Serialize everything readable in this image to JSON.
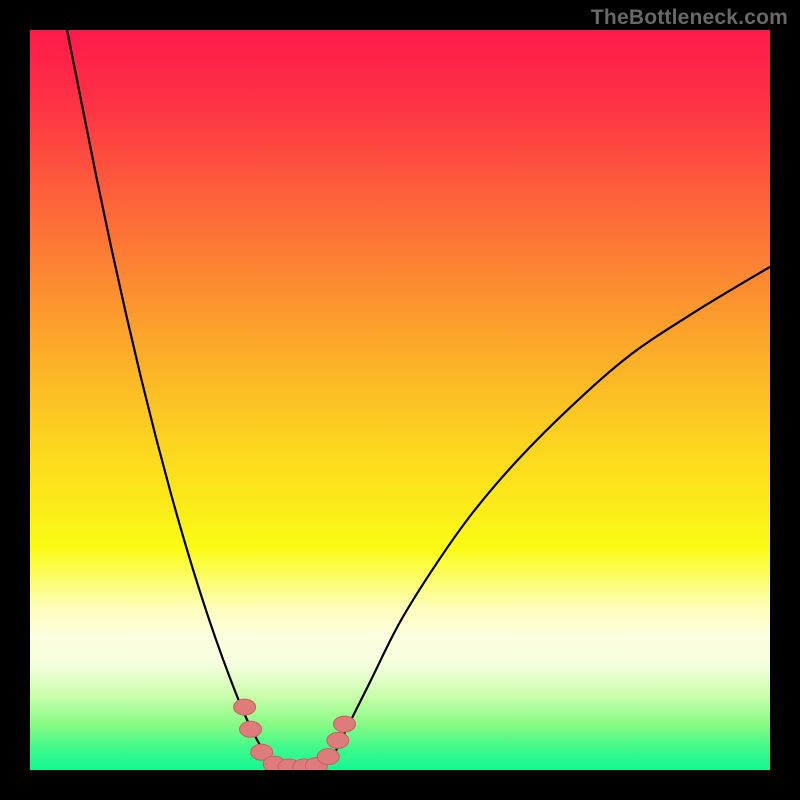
{
  "watermark": "TheBottleneck.com",
  "colors": {
    "frame": "#000000",
    "curve": "#000000",
    "marker_fill": "#dd7c7b",
    "marker_stroke": "#c96160",
    "gradient_stops": [
      {
        "offset": 0.0,
        "color": "#fe1a4b"
      },
      {
        "offset": 0.1,
        "color": "#fe3245"
      },
      {
        "offset": 0.25,
        "color": "#fd6a38"
      },
      {
        "offset": 0.4,
        "color": "#fca02c"
      },
      {
        "offset": 0.55,
        "color": "#fcd220"
      },
      {
        "offset": 0.7,
        "color": "#fbfb15"
      },
      {
        "offset": 0.78,
        "color": "#fdfeb9"
      },
      {
        "offset": 0.82,
        "color": "#fdfee0"
      },
      {
        "offset": 0.86,
        "color": "#f3fedc"
      },
      {
        "offset": 0.9,
        "color": "#c9fdaa"
      },
      {
        "offset": 0.94,
        "color": "#84fb84"
      },
      {
        "offset": 0.97,
        "color": "#40f98b"
      },
      {
        "offset": 1.0,
        "color": "#14f891"
      }
    ]
  },
  "chart_data": {
    "type": "line",
    "title": "",
    "xlabel": "",
    "ylabel": "",
    "xlim": [
      0,
      100
    ],
    "ylim": [
      0,
      100
    ],
    "grid": false,
    "legend": false,
    "curve_left": {
      "x": [
        5,
        7,
        9,
        11,
        13,
        15,
        17,
        19,
        21,
        23,
        25,
        27,
        29,
        31,
        32.5,
        33.5
      ],
      "y": [
        100,
        90,
        80,
        70.5,
        61.5,
        53,
        45,
        37.5,
        30.5,
        24,
        18,
        12.5,
        7.5,
        3.5,
        1.2,
        0.3
      ]
    },
    "curve_right": {
      "x": [
        39.5,
        41,
        43,
        46,
        50,
        55,
        60,
        66,
        73,
        81,
        90,
        100
      ],
      "y": [
        0.3,
        2,
        6,
        12,
        20,
        28,
        35,
        42,
        49,
        56,
        62,
        68
      ]
    },
    "markers": [
      {
        "x": 29.0,
        "y": 8.5
      },
      {
        "x": 29.8,
        "y": 5.5
      },
      {
        "x": 31.3,
        "y": 2.4
      },
      {
        "x": 33.0,
        "y": 0.8
      },
      {
        "x": 35.0,
        "y": 0.4
      },
      {
        "x": 37.0,
        "y": 0.4
      },
      {
        "x": 38.7,
        "y": 0.6
      },
      {
        "x": 40.3,
        "y": 1.8
      },
      {
        "x": 41.6,
        "y": 4.0
      },
      {
        "x": 42.5,
        "y": 6.2
      }
    ]
  }
}
